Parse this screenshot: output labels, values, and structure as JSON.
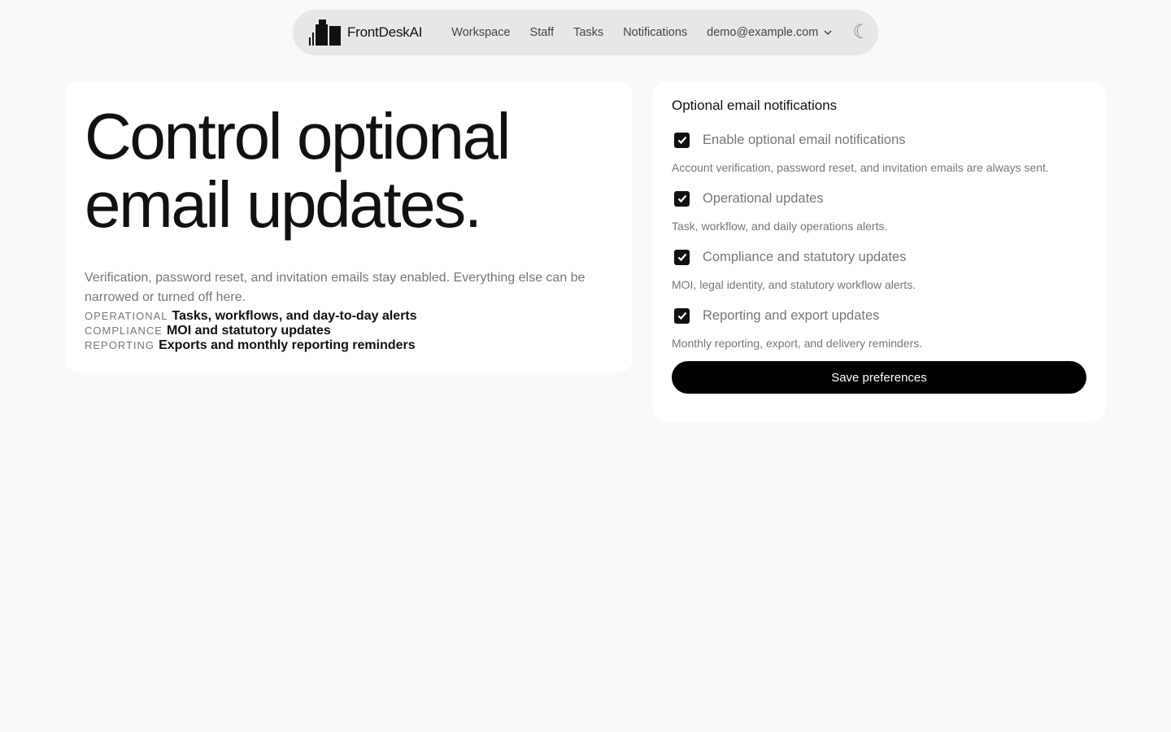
{
  "nav": {
    "brand": "FrontDeskAI",
    "links": [
      "Workspace",
      "Staff",
      "Tasks",
      "Notifications"
    ],
    "account": "demo@example.com",
    "theme_icon": "moon-icon"
  },
  "hero": {
    "title": "Control optional email updates.",
    "description": "Verification, password reset, and invitation emails stay enabled. Everything else can be narrowed or turned off here.",
    "items": [
      {
        "tag": "OPERATIONAL",
        "value": "Tasks, workflows, and day-to-day alerts"
      },
      {
        "tag": "COMPLIANCE",
        "value": "MOI and statutory updates"
      },
      {
        "tag": "REPORTING",
        "value": "Exports and monthly reporting reminders"
      }
    ]
  },
  "prefs": {
    "title": "Optional email notifications",
    "options": [
      {
        "label": "Enable optional email notifications",
        "help": "Account verification, password reset, and invitation emails are always sent.",
        "checked": true
      },
      {
        "label": "Operational updates",
        "help": "Task, workflow, and daily operations alerts.",
        "checked": true
      },
      {
        "label": "Compliance and statutory updates",
        "help": "MOI, legal identity, and statutory workflow alerts.",
        "checked": true
      },
      {
        "label": "Reporting and export updates",
        "help": "Monthly reporting, export, and delivery reminders.",
        "checked": true
      }
    ],
    "save_label": "Save preferences"
  }
}
